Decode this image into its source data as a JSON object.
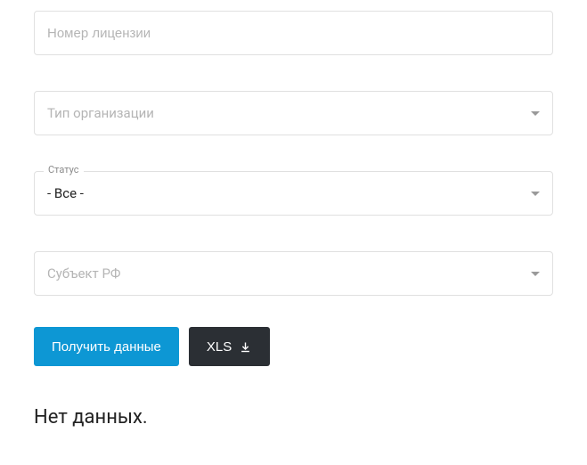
{
  "fields": {
    "license": {
      "placeholder": "Номер лицензии",
      "value": ""
    },
    "orgType": {
      "placeholder": "Тип организации",
      "value": ""
    },
    "status": {
      "label": "Статус",
      "value": "- Все -"
    },
    "region": {
      "placeholder": "Субъект РФ",
      "value": ""
    }
  },
  "buttons": {
    "submit": "Получить данные",
    "export": "XLS"
  },
  "results": {
    "empty_message": "Нет данных."
  }
}
